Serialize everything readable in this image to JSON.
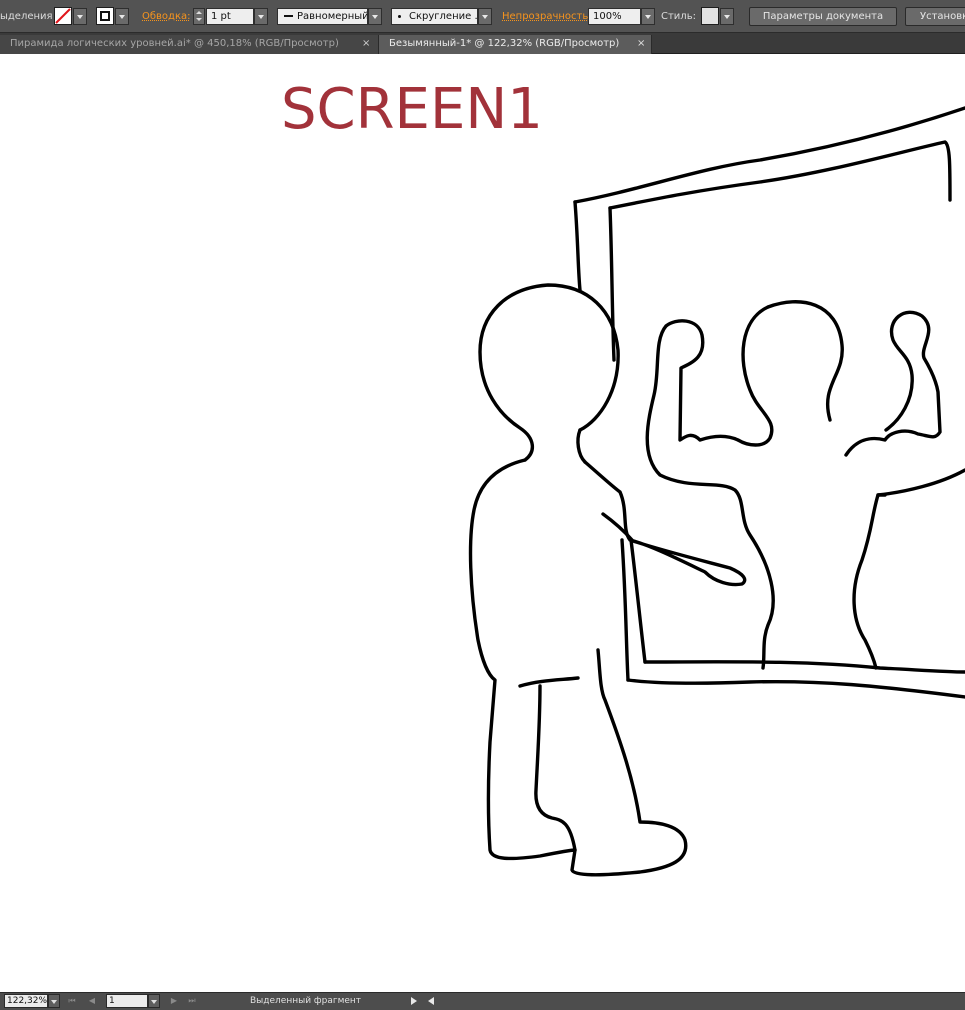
{
  "controlbar": {
    "selection_label": "ыделения",
    "stroke_label": "Обводка:",
    "stroke_weight": "1 pt",
    "profile": "Равномерный",
    "brush": "Скругление ...",
    "opacity_label": "Непрозрачность:",
    "opacity_value": "100%",
    "style_label": "Стиль:",
    "doc_settings_button": "Параметры документа",
    "preferences_button": "Установки",
    "fill_color": "none",
    "accent_color": "#f7941d"
  },
  "tabs": [
    {
      "label": "Пирамида логических уровней.ai* @ 450,18% (RGB/Просмотр)",
      "close": "×",
      "active": false
    },
    {
      "label": "Безымянный-1* @ 122,32% (RGB/Просмотр)",
      "close": "×",
      "active": true
    }
  ],
  "canvas": {
    "title": "SCREEN1",
    "title_color": "#a2323a"
  },
  "statusbar": {
    "zoom": "122,32%",
    "artboard": "1",
    "status": "Выделенный фрагмент"
  }
}
